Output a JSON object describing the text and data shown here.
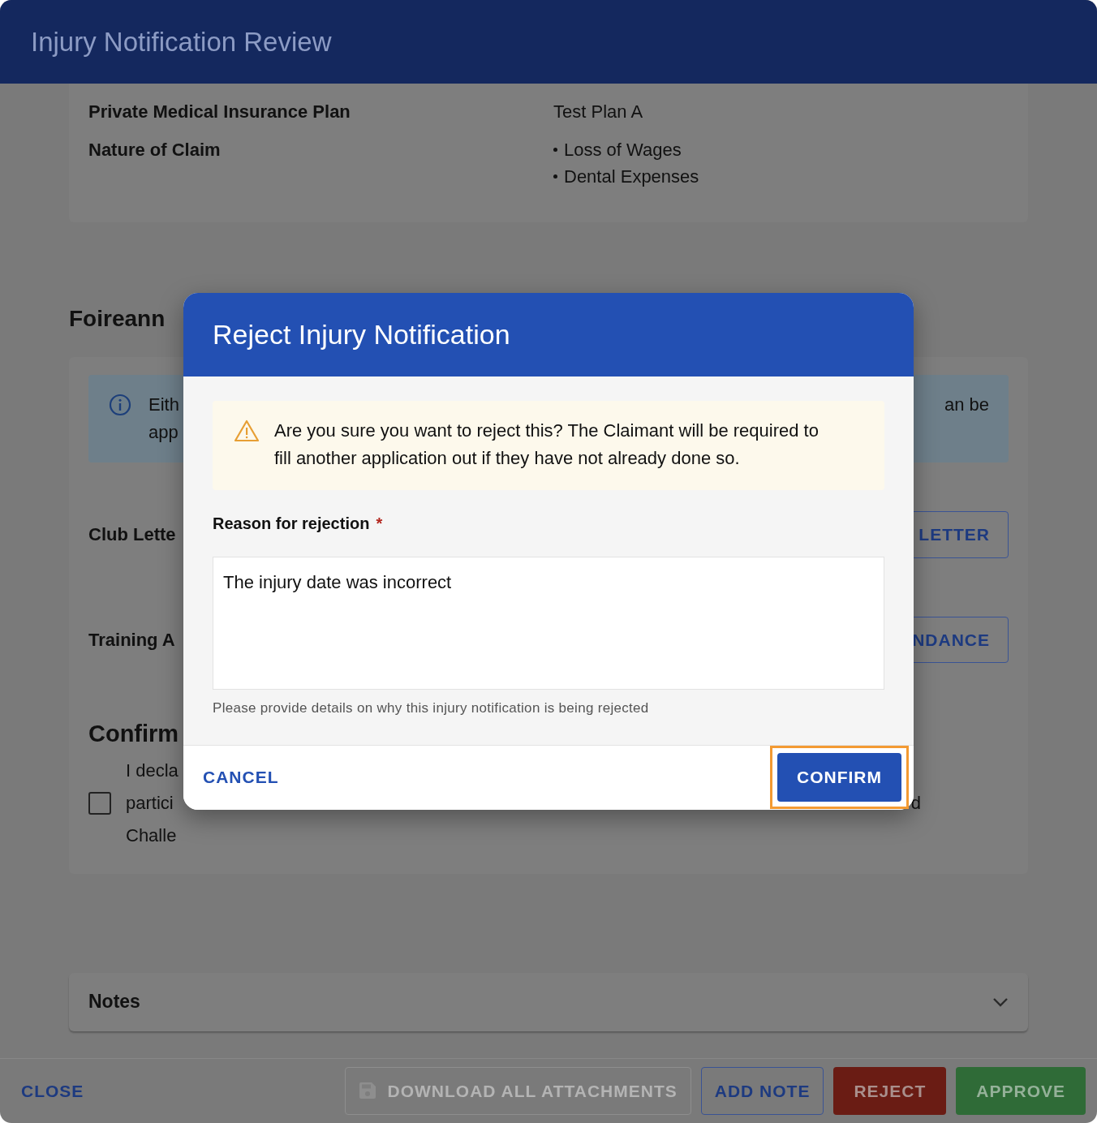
{
  "window": {
    "title": "Injury Notification Review"
  },
  "summary": {
    "rows": [
      {
        "label": "Private Medical Insurance Plan",
        "kind": "text",
        "values": [
          "Test Plan A"
        ]
      },
      {
        "label": "Nature of Claim",
        "kind": "bullets",
        "values": [
          "Loss of Wages",
          "Dental Expenses"
        ]
      }
    ]
  },
  "section": {
    "heading": "Foireann",
    "info": {
      "lines": [
        "Eith",
        "app"
      ],
      "tail": "an be"
    },
    "rows": [
      {
        "label": "Club Lette",
        "button": "LETTER"
      },
      {
        "label": "Training A",
        "button": "NDANCE"
      }
    ],
    "confirm": {
      "heading": "Confirm",
      "checked": false,
      "lines": [
        "I decla",
        "partici",
        "Challe"
      ],
      "tail": "d"
    }
  },
  "notes": {
    "title": "Notes",
    "expanded": false
  },
  "footer": {
    "buttons": [
      {
        "label": "CLOSE",
        "kind": "text",
        "disabled": false
      },
      {
        "label": "DOWNLOAD ALL ATTACHMENTS",
        "kind": "outline",
        "disabled": true
      },
      {
        "label": "ADD NOTE",
        "kind": "outline",
        "disabled": false
      },
      {
        "label": "REJECT",
        "kind": "danger",
        "disabled": false
      },
      {
        "label": "APPROVE",
        "kind": "success",
        "disabled": false
      }
    ]
  },
  "dialog": {
    "title": "Reject Injury Notification",
    "warning": "Are you sure you want to reject this? The Claimant will be required to fill another application out if they have not already done so.",
    "field": {
      "label": "Reason for rejection",
      "required": true,
      "required_mark": "*",
      "value": "The injury date was incorrect",
      "helper": "Please provide details on why this injury notification is being rejected"
    },
    "buttons": [
      {
        "label": "CANCEL",
        "kind": "text",
        "focused": false
      },
      {
        "label": "CONFIRM",
        "kind": "primary",
        "focused": true
      }
    ]
  }
}
